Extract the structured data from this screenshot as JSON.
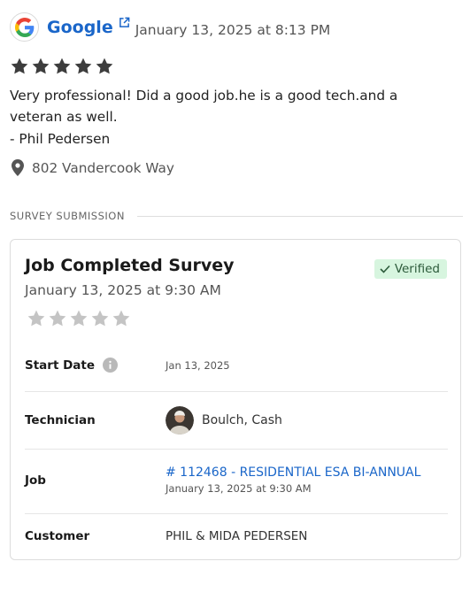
{
  "review": {
    "source": "Google",
    "date": "January 13, 2025 at 8:13 PM",
    "rating": 5,
    "text": "Very professional! Did a good job.he is a good tech.and a veteran as well.",
    "author": "- Phil Pedersen",
    "address": "802 Vandercook Way"
  },
  "section_label": "SURVEY SUBMISSION",
  "survey": {
    "title": "Job Completed Survey",
    "date": "January 13, 2025 at 9:30 AM",
    "status": "Verified",
    "rating": 0,
    "start_date": {
      "label": "Start Date",
      "value": "Jan 13, 2025"
    },
    "technician": {
      "label": "Technician",
      "value": "Boulch, Cash"
    },
    "job": {
      "label": "Job",
      "link": "# 112468 - RESIDENTIAL ESA BI-ANNUAL",
      "date": "January 13, 2025 at 9:30 AM"
    },
    "customer": {
      "label": "Customer",
      "value": "PHIL & MIDA PEDERSEN"
    }
  },
  "colors": {
    "link": "#1a66c9",
    "verified_bg": "#d7f5df",
    "star_filled": "#3d3d3d",
    "star_empty": "#c4c4c4"
  }
}
